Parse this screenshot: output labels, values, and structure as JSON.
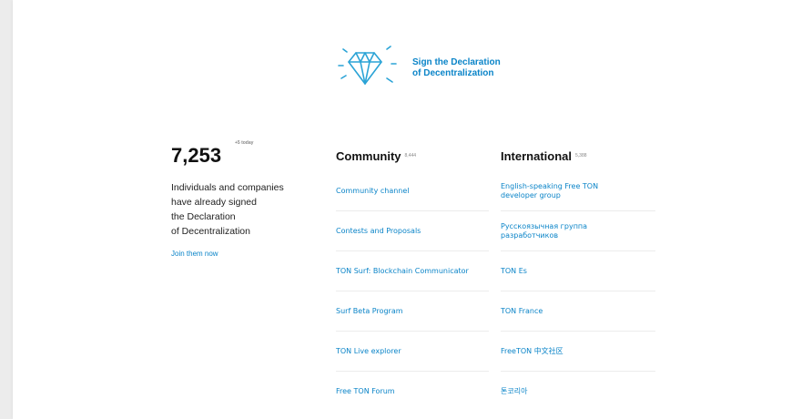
{
  "sign": {
    "line1": "Sign the Declaration",
    "line2": "of Decentralization"
  },
  "stats": {
    "count": "7,253",
    "today": "+5 today",
    "desc_lines": [
      "Individuals and companies",
      "have already signed",
      "the Declaration",
      "of Decentralization"
    ],
    "join_label": "Join them now"
  },
  "community": {
    "title": "Community",
    "count": "8,444",
    "links": [
      "Community channel",
      "Contests and Proposals",
      "TON Surf: Blockchain Communicator",
      "Surf Beta Program",
      "TON Live explorer",
      "Free TON Forum"
    ]
  },
  "international": {
    "title": "International",
    "count": "5,388",
    "links": [
      [
        "English-speaking Free TON",
        "developer group"
      ],
      [
        "Русскоязычная группа",
        "разработчиков"
      ],
      [
        "TON Es"
      ],
      [
        "TON France"
      ],
      [
        "FreeTON 中文社区"
      ],
      [
        "톤코리아"
      ]
    ]
  },
  "colors": {
    "accent": "#0a84c8",
    "icon": "#2aa3d6",
    "text": "#111111"
  },
  "icons": {
    "diamond": "diamond-icon"
  }
}
